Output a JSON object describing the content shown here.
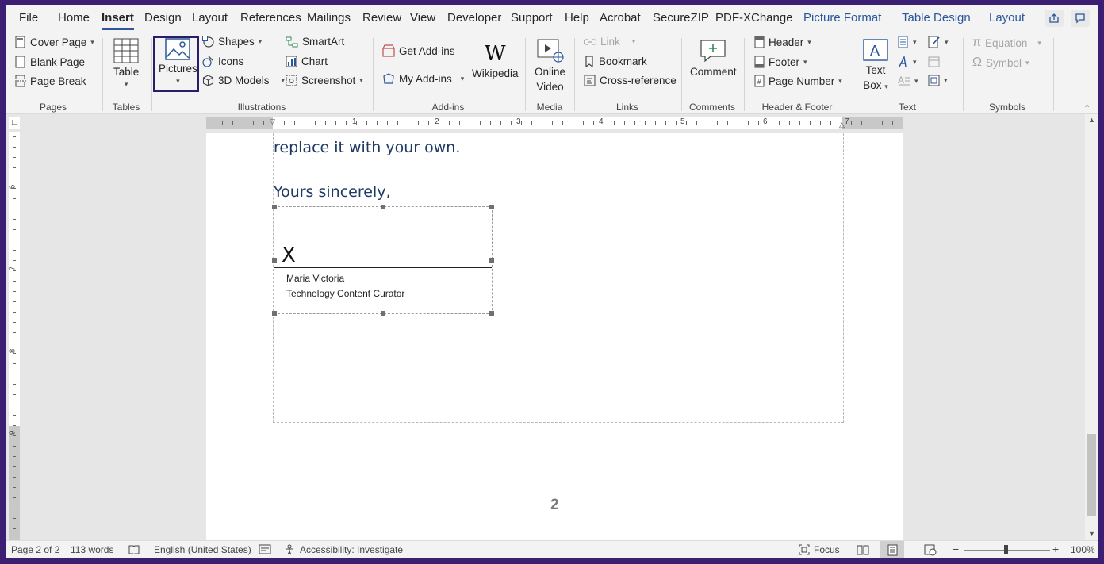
{
  "menu_tabs": [
    {
      "label": "File"
    },
    {
      "label": "Home"
    },
    {
      "label": "Insert"
    },
    {
      "label": "Design"
    },
    {
      "label": "Layout"
    },
    {
      "label": "References"
    },
    {
      "label": "Mailings"
    },
    {
      "label": "Review"
    },
    {
      "label": "View"
    },
    {
      "label": "Developer"
    },
    {
      "label": "Support"
    },
    {
      "label": "Help"
    },
    {
      "label": "Acrobat"
    },
    {
      "label": "SecureZIP"
    },
    {
      "label": "PDF-XChange"
    },
    {
      "label": "Picture Format"
    },
    {
      "label": "Table Design"
    },
    {
      "label": "Layout"
    }
  ],
  "active_tab": "Insert",
  "ribbon": {
    "pages": {
      "cover_page": "Cover Page",
      "blank_page": "Blank Page",
      "page_break": "Page Break",
      "group": "Pages"
    },
    "tables": {
      "table": "Table",
      "group": "Tables"
    },
    "illustrations": {
      "pictures": "Pictures",
      "shapes": "Shapes",
      "icons": "Icons",
      "models_3d": "3D Models",
      "smartart": "SmartArt",
      "chart": "Chart",
      "screenshot": "Screenshot",
      "group": "Illustrations"
    },
    "addins": {
      "get_addins": "Get Add-ins",
      "my_addins": "My Add-ins",
      "wikipedia": "Wikipedia",
      "group": "Add-ins"
    },
    "media": {
      "online": "Online",
      "video": "Video",
      "group": "Media"
    },
    "links": {
      "link": "Link",
      "bookmark": "Bookmark",
      "cross_reference": "Cross-reference",
      "group": "Links"
    },
    "comments": {
      "comment": "Comment",
      "group": "Comments"
    },
    "header_footer": {
      "header": "Header",
      "footer": "Footer",
      "page_number": "Page Number",
      "group": "Header & Footer"
    },
    "text": {
      "text_box_1": "Text",
      "text_box_2": "Box",
      "group": "Text"
    },
    "symbols": {
      "equation": "Equation",
      "symbol": "Symbol",
      "group": "Symbols"
    }
  },
  "ruler": {
    "h_numbers": [
      "1",
      "2",
      "3",
      "4",
      "5",
      "6",
      "7"
    ],
    "v_numbers": [
      "6",
      "7",
      "8",
      "9"
    ]
  },
  "document": {
    "line1": "replace it with your own.",
    "line2": "Yours sincerely,",
    "signature_x": "X",
    "signer_name": "Maria Victoria",
    "signer_title": "Technology Content Curator",
    "page_number": "2"
  },
  "status_bar": {
    "page": "Page 2 of 2",
    "words": "113 words",
    "language": "English (United States)",
    "accessibility": "Accessibility: Investigate",
    "focus": "Focus",
    "zoom": "100%",
    "zoom_level": 1.0
  },
  "colors": {
    "accent": "#2b579a",
    "selection_frame": "#2b1b6b",
    "document_text": "#1e3a63",
    "window_border": "#3a1f72"
  }
}
